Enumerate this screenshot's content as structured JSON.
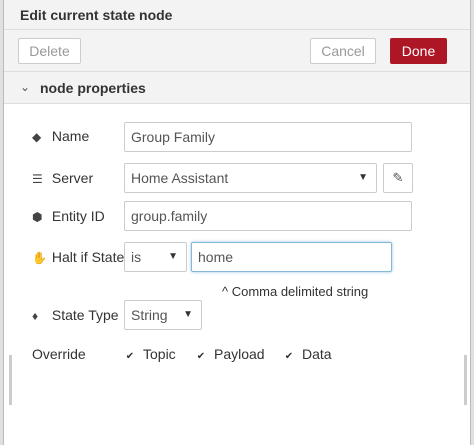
{
  "dialog": {
    "title": "Edit current state node"
  },
  "toolbar": {
    "delete_label": "Delete",
    "cancel_label": "Cancel",
    "done_label": "Done"
  },
  "section": {
    "label": "node properties"
  },
  "fields": {
    "name": {
      "label": "Name",
      "value": "Group Family"
    },
    "server": {
      "label": "Server",
      "value": "Home Assistant"
    },
    "entity_id": {
      "label": "Entity ID",
      "value": "group.family"
    },
    "halt_if_state": {
      "label": "Halt if State",
      "operator": "is",
      "value": "home",
      "hint": "^ Comma delimited string"
    },
    "state_type": {
      "label": "State Type",
      "value": "String"
    },
    "override": {
      "label": "Override",
      "options": [
        {
          "label": "Topic",
          "checked": true
        },
        {
          "label": "Payload",
          "checked": true
        },
        {
          "label": "Data",
          "checked": true
        }
      ]
    }
  },
  "colors": {
    "done_button": "#ad1625",
    "focus_border": "#85b7d9"
  }
}
